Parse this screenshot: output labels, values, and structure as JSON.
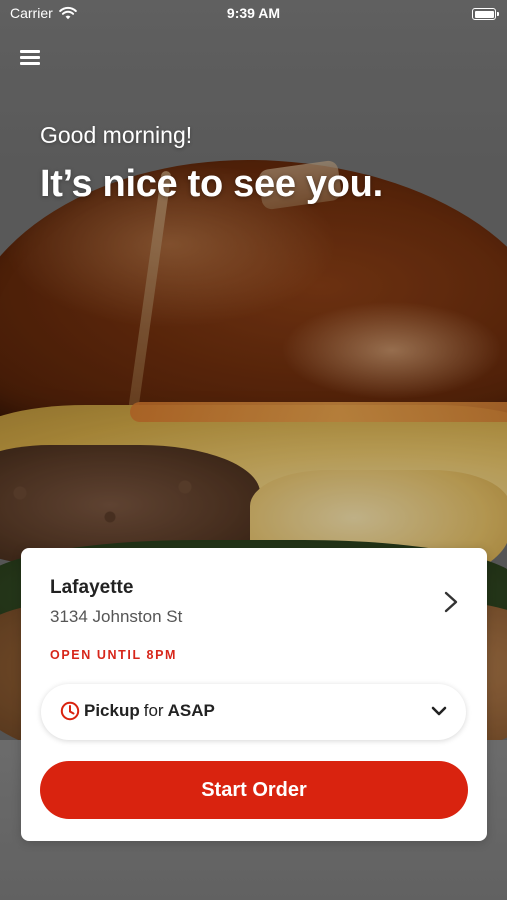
{
  "status_bar": {
    "carrier": "Carrier",
    "time": "9:39 AM",
    "wifi_icon": "wifi-icon",
    "battery_icon": "battery-icon"
  },
  "header": {
    "menu_icon": "hamburger-menu-icon"
  },
  "hero": {
    "greeting": "Good morning!",
    "headline": "It’s nice to see you.",
    "background_image": "burger-photo"
  },
  "store_card": {
    "name": "Lafayette",
    "address": "3134 Johnston St",
    "hours": "OPEN UNTIL 8PM",
    "hours_color": "#d7261a",
    "chevron_icon": "chevron-right-icon"
  },
  "order_mode": {
    "mode": "Pickup",
    "connector": "for",
    "time": "ASAP",
    "clock_icon": "clock-icon",
    "chevron_icon": "chevron-down-icon"
  },
  "cta": {
    "label": "Start Order",
    "color": "#d9230f"
  }
}
